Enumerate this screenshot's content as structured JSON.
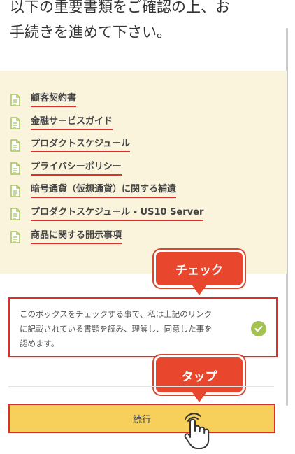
{
  "header": {
    "title": "以下の重要書類をご確認の上、お\n手続きを進めて下さい。"
  },
  "documents": [
    {
      "label": "顧客契約書"
    },
    {
      "label": "金融サービスガイド"
    },
    {
      "label": "プロダクトスケジュール"
    },
    {
      "label": "プライバシーポリシー"
    },
    {
      "label": "暗号通貨（仮想通貨）に関する補遺"
    },
    {
      "label": "プロダクトスケジュール - US10 Server"
    },
    {
      "label": "商品に関する開示事項"
    }
  ],
  "callouts": {
    "check": "チェック",
    "tap": "タップ"
  },
  "consent": {
    "text": "このボックスをチェックする事で、私は上記のリンク\nに記載されている書類を読み、理解し、同意した事を\n認めます。",
    "checked": true
  },
  "actions": {
    "continue_label": "続行"
  },
  "colors": {
    "accent_red": "#d9302a",
    "callout_red": "#e8472e",
    "panel_bg": "#fbf4dc",
    "button_yellow": "#f6d05a",
    "check_green": "#a4c153",
    "doc_icon_green": "#a6c35e"
  },
  "icons": {
    "document": "document-icon",
    "check": "check-circle-icon",
    "hand": "tap-hand-icon"
  }
}
